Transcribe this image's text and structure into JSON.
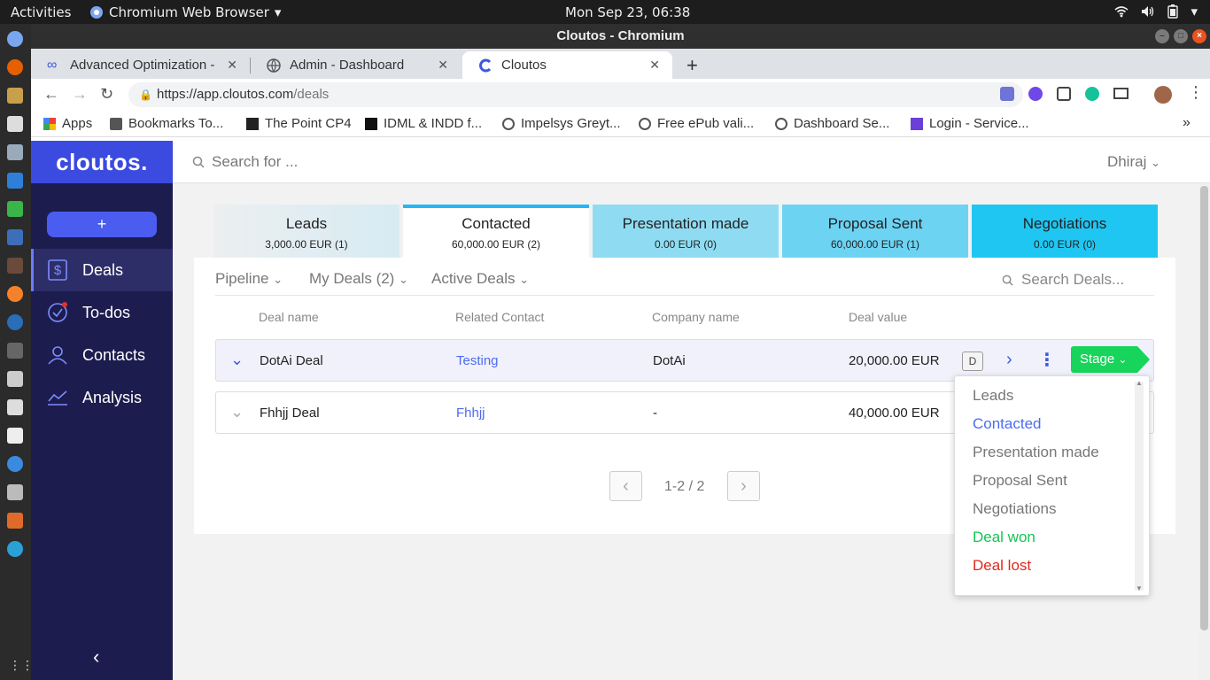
{
  "os": {
    "activities": "Activities",
    "app_name": "Chromium Web Browser",
    "clock": "Mon Sep 23, 06:38"
  },
  "window": {
    "title": "Cloutos - Chromium"
  },
  "tabs": [
    {
      "label": "Advanced Optimization -"
    },
    {
      "label": "Admin - Dashboard"
    },
    {
      "label": "Cloutos"
    }
  ],
  "address": {
    "url_host": "https://app.cloutos.com",
    "url_path": "/deals"
  },
  "bookmarks": [
    {
      "label": "Apps"
    },
    {
      "label": "Bookmarks To..."
    },
    {
      "label": "The Point CP4"
    },
    {
      "label": "IDML & INDD f..."
    },
    {
      "label": "Impelsys Greyt..."
    },
    {
      "label": "Free ePub vali..."
    },
    {
      "label": "Dashboard Se..."
    },
    {
      "label": "Login - Service..."
    }
  ],
  "sidebar": {
    "logo": "cloutos.",
    "add_label": "+",
    "items": [
      {
        "label": "Deals",
        "icon": "dollar-icon"
      },
      {
        "label": "To-dos",
        "icon": "check-circle-icon"
      },
      {
        "label": "Contacts",
        "icon": "users-icon"
      },
      {
        "label": "Analysis",
        "icon": "chart-icon"
      }
    ],
    "collapse": "‹"
  },
  "header": {
    "search_placeholder": "Search for ...",
    "user": "Dhiraj"
  },
  "stages": [
    {
      "name": "Leads",
      "value": "3,000.00 EUR (1)",
      "color": "#dcecf2"
    },
    {
      "name": "Contacted",
      "value": "60,000.00 EUR (2)",
      "color": "#ffffff"
    },
    {
      "name": "Presentation made",
      "value": "0.00 EUR (0)",
      "color": "#8fdcf2"
    },
    {
      "name": "Proposal Sent",
      "value": "60,000.00 EUR (1)",
      "color": "#6dd5f3"
    },
    {
      "name": "Negotiations",
      "value": "0.00 EUR (0)",
      "color": "#1fc6f2"
    }
  ],
  "filters": {
    "pipeline": "Pipeline",
    "mydeals": "My Deals (2)",
    "active": "Active Deals",
    "search_placeholder": "Search Deals..."
  },
  "table": {
    "headers": [
      "Deal name",
      "Related Contact",
      "Company name",
      "Deal value"
    ],
    "rows": [
      {
        "name": "DotAi Deal",
        "contact": "Testing",
        "company": "DotAi",
        "value": "20,000.00 EUR",
        "badge": "D",
        "stage": "Stage"
      },
      {
        "name": "Fhhjj Deal",
        "contact": "Fhhjj",
        "company": "-",
        "value": "40,000.00 EUR"
      }
    ]
  },
  "pagination": {
    "text": "1-2 / 2",
    "prev": "‹",
    "next": "›"
  },
  "stage_dropdown": {
    "options": [
      {
        "label": "Leads",
        "color": "#777777"
      },
      {
        "label": "Contacted",
        "color": "#4d6cf0"
      },
      {
        "label": "Presentation made",
        "color": "#777777"
      },
      {
        "label": "Proposal Sent",
        "color": "#777777"
      },
      {
        "label": "Negotiations",
        "color": "#777777"
      },
      {
        "label": "Deal won",
        "color": "#17c455"
      },
      {
        "label": "Deal lost",
        "color": "#e0281e"
      }
    ]
  }
}
